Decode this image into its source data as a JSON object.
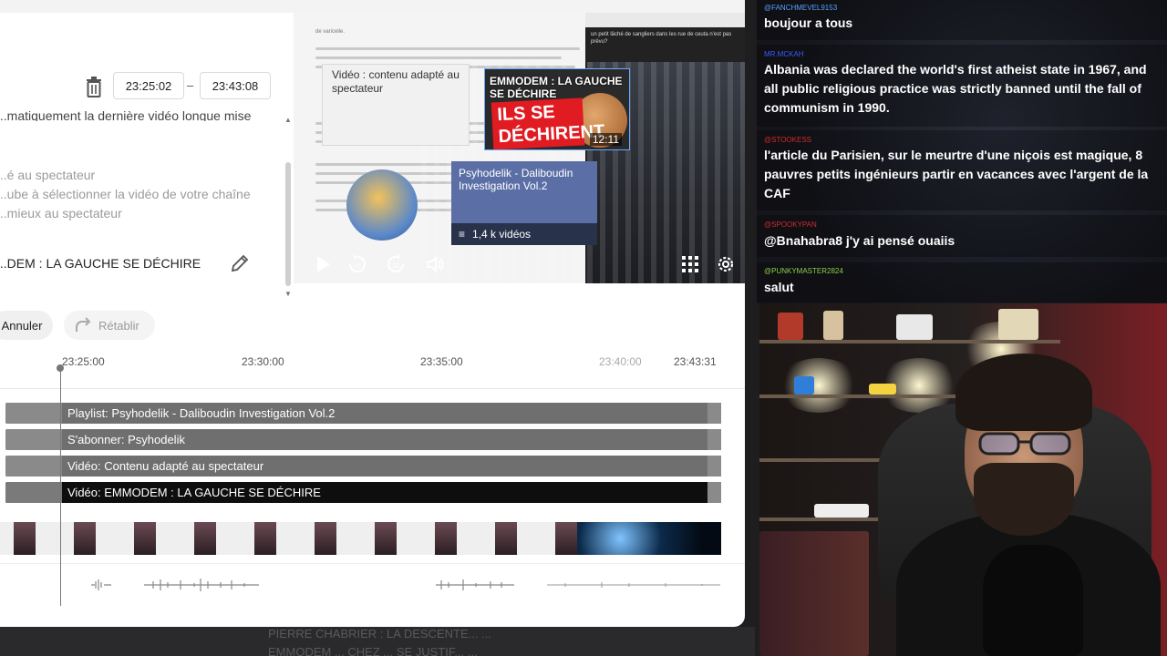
{
  "editor": {
    "start_time": "23:25:02",
    "end_time": "23:43:08",
    "separator": "–",
    "desc_line": "...matiquement la dernière vidéo longue mise",
    "options": [
      "...é au spectateur",
      "...ube à sélectionner la vidéo de votre chaîne",
      "...mieux au spectateur"
    ],
    "selected_video": "...DEM : LA GAUCHE SE DÉCHIRE",
    "cancel_label": "Annuler",
    "redo_label": "Rétablir"
  },
  "preview": {
    "video_card_label": "Vidéo : contenu adapté au spectateur",
    "emm_title": "EMMODEM : LA GAUCHE SE DÉCHIRE",
    "emm_big_text": "ILS SE DÉCHIRENT",
    "emm_duration": "12:11",
    "playlist_title": "Psyhodelik - Daliboudin Investigation Vol.2",
    "playlist_count": "1,4 k vidéos",
    "mini_chat_text": "un petit lâché de sangliers dans les rue de ceuta n'est pas prévu?",
    "doc_text": "de varicelle."
  },
  "timeline": {
    "ticks": [
      "23:25:00",
      "23:30:00",
      "23:35:00",
      "23:40:00",
      "23:43:31"
    ],
    "tracks": [
      "Playlist: Psyhodelik - Daliboudin Investigation Vol.2",
      "S'abonner: Psyhodelik",
      "Vidéo: Contenu adapté au spectateur",
      "Vidéo: EMMODEM : LA GAUCHE SE DÉCHIRE"
    ]
  },
  "background": {
    "ghost_lines": [
      "PIERRE CHABRIER : LA DESCENTE...   ...",
      "EMMODEM ...  CHEZ ...  SE JUSTIF...  ..."
    ]
  },
  "chat": {
    "messages": [
      {
        "user": "@FANCHMEVEL9153",
        "user_color": "#5aa0ff",
        "text": "boujour a tous"
      },
      {
        "user": "MR.MCKAH",
        "user_color": "#3b5bff",
        "text": "Albania was declared the world's first atheist state in 1967, and all public religious practice was strictly banned until the fall of communism in 1990."
      },
      {
        "user": "@STOOKESS",
        "user_color": "#d22c2c",
        "text": "l'article du Parisien, sur le meurtre d'une niçois est magique, 8 pauvres petits ingénieurs partir en vacances avec l'argent de la CAF"
      },
      {
        "user": "@SPOOKYPAN",
        "user_color": "#d22c2c",
        "text": "@Bnahabra8 j'y ai pensé ouaiis"
      },
      {
        "user": "@PUNKYMASTER2824",
        "user_color": "#8ad14a",
        "text": "salut"
      }
    ]
  }
}
